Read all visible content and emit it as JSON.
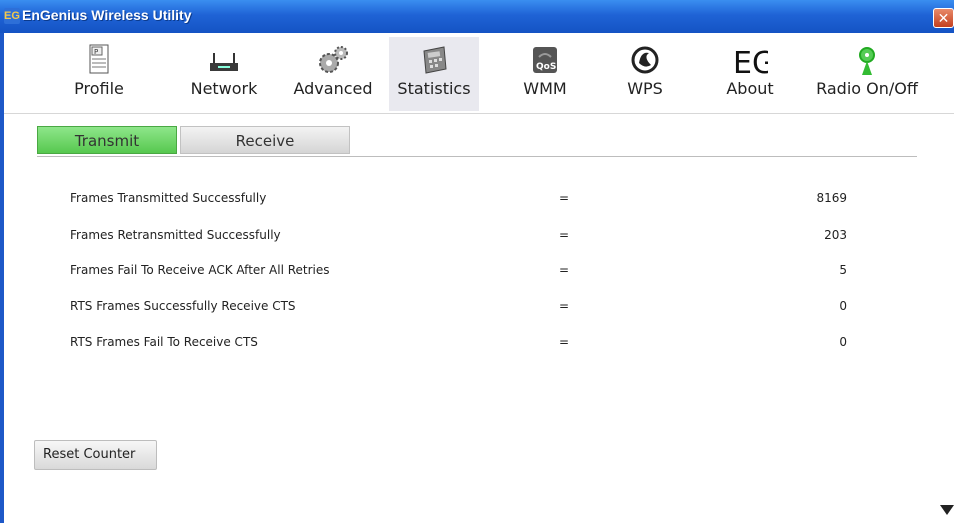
{
  "window": {
    "title": "EnGenius Wireless Utility",
    "logo_text": "EG",
    "close_symbol": "✕"
  },
  "toolbar": [
    {
      "label": "Profile",
      "icon": "profile-icon"
    },
    {
      "label": "Network",
      "icon": "network-icon"
    },
    {
      "label": "Advanced",
      "icon": "advanced-gears-icon"
    },
    {
      "label": "Statistics",
      "icon": "statistics-calculator-icon",
      "active": true
    },
    {
      "label": "WMM",
      "icon": "qos-wmm-icon",
      "icon_text": "QoS"
    },
    {
      "label": "WPS",
      "icon": "wps-icon"
    },
    {
      "label": "About",
      "icon": "eg-about-icon",
      "icon_text": "EG"
    },
    {
      "label": "Radio On/Off",
      "icon": "radio-antenna-icon"
    }
  ],
  "tabs": {
    "transmit": "Transmit",
    "receive": "Receive"
  },
  "stats": [
    {
      "label": "Frames Transmitted Successfully",
      "sep": "=",
      "value": "8169"
    },
    {
      "label": "Frames Retransmitted Successfully",
      "sep": "=",
      "value": "203"
    },
    {
      "label": "Frames Fail To Receive ACK After All Retries",
      "sep": "=",
      "value": "5"
    },
    {
      "label": "RTS Frames Successfully Receive CTS",
      "sep": "=",
      "value": "0"
    },
    {
      "label": "RTS Frames Fail To Receive CTS",
      "sep": "=",
      "value": "0"
    }
  ],
  "buttons": {
    "reset": "Reset Counter"
  },
  "colors": {
    "titlebar": "#1f63d6",
    "active_tab": "#57c84f"
  }
}
